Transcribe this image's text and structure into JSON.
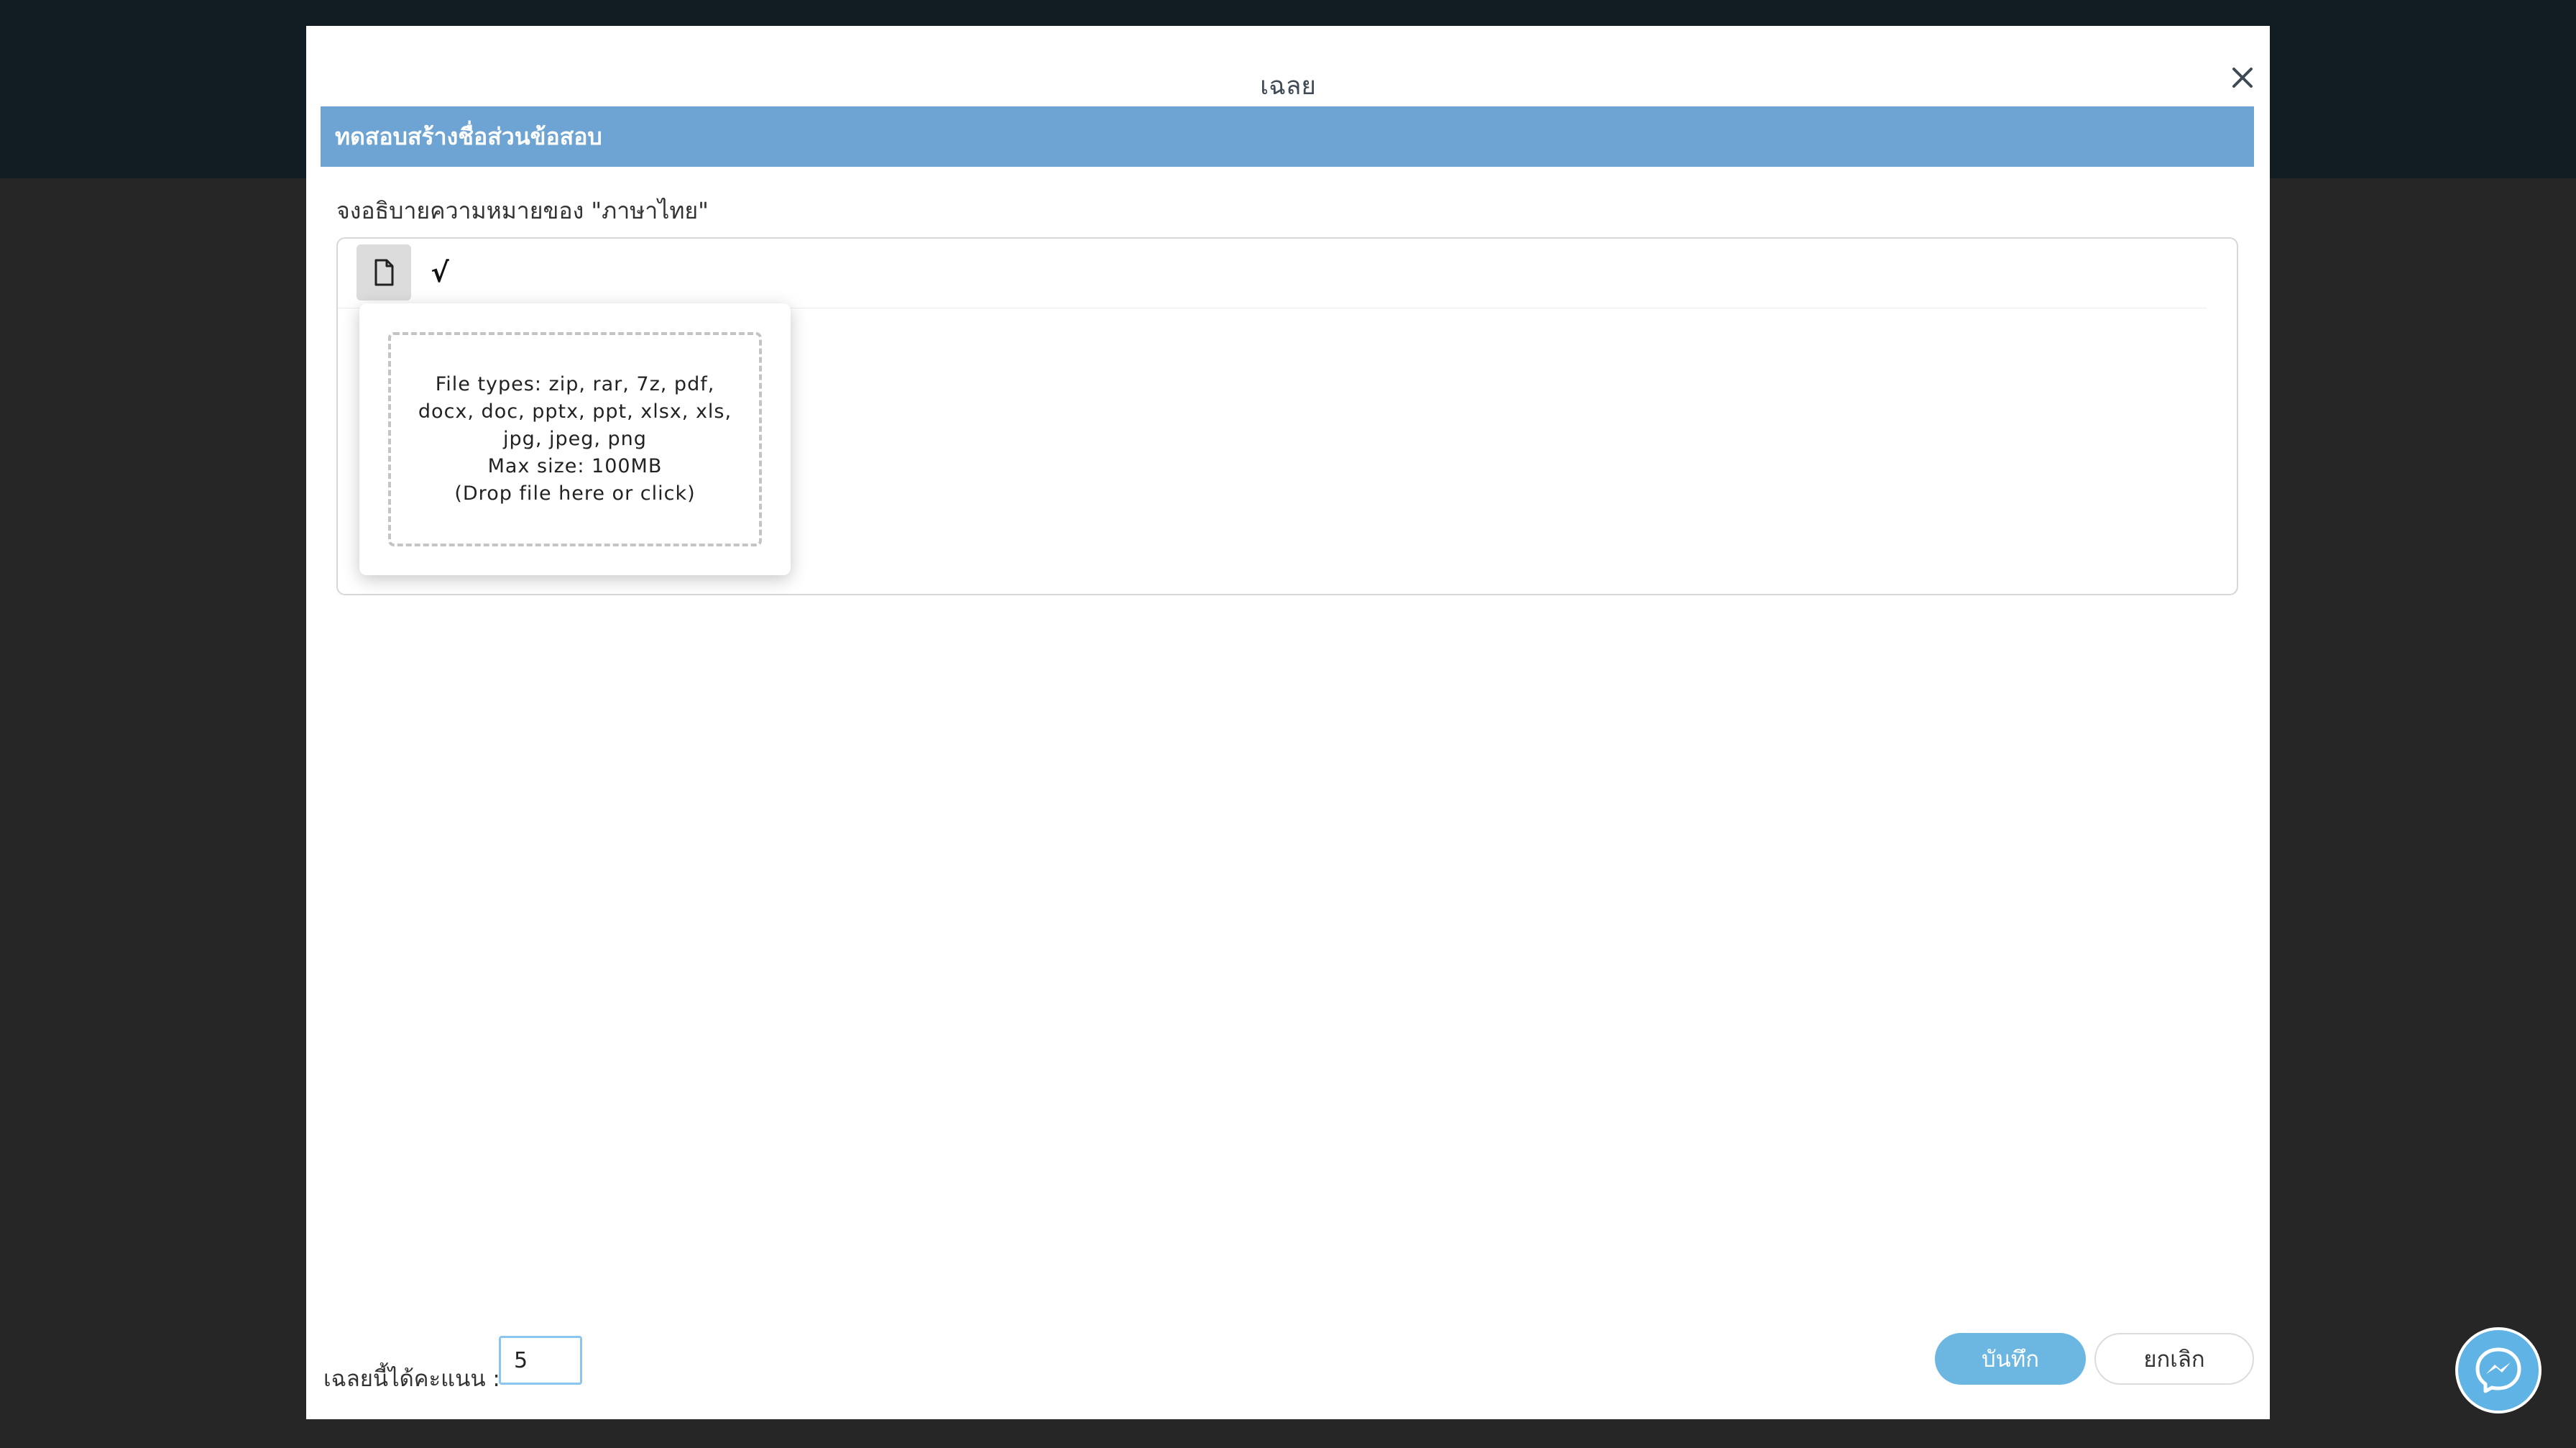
{
  "modal": {
    "title": "เฉลย"
  },
  "section": {
    "title": "ทดสอบสร้างชื่อส่วนข้อสอบ"
  },
  "question": {
    "text": "จงอธิบายความหมายของ \"ภาษาไทย\""
  },
  "toolbar": {
    "math_symbol": "√"
  },
  "upload": {
    "line1": "File types: zip, rar, 7z, pdf,",
    "line2": "docx, doc, pptx, ppt, xlsx, xls,",
    "line3": "jpg, jpeg, png",
    "line4": "Max size: 100MB",
    "line5": "(Drop file here or click)"
  },
  "footer": {
    "score_label": "เฉลยนี้ได้คะแนน :",
    "score_value": "5",
    "save_label": "บันทึก",
    "cancel_label": "ยกเลิก"
  },
  "colors": {
    "section_bar": "#6ea4d3",
    "save_button": "#6bb7e2",
    "messenger": "#5fb3e5"
  },
  "icons": {
    "close": "close-icon",
    "file": "file-icon",
    "messenger": "messenger-icon"
  }
}
